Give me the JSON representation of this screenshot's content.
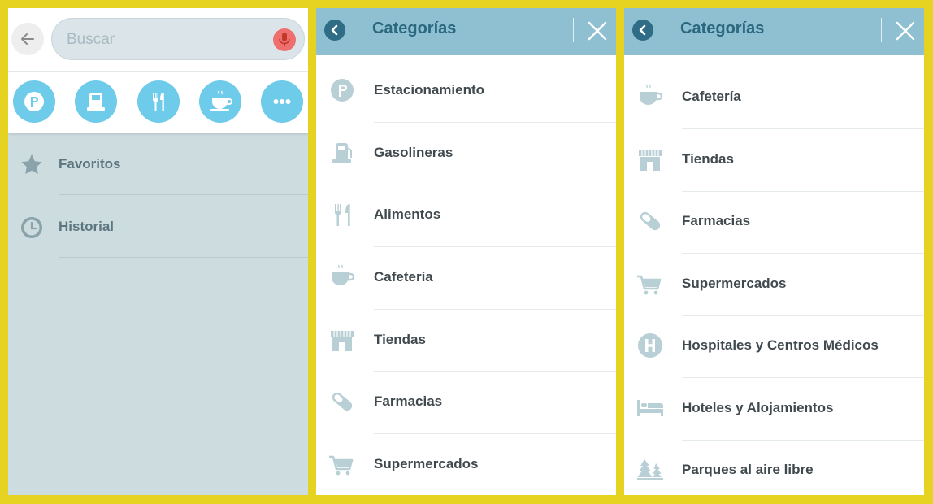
{
  "search_panel": {
    "search_placeholder": "Buscar",
    "quick_categories": [
      "parking-icon",
      "gas-station-icon",
      "food-icon",
      "coffee-icon",
      "more-icon"
    ],
    "items": [
      {
        "label": "Favoritos",
        "icon": "star-icon"
      },
      {
        "label": "Historial",
        "icon": "clock-icon"
      }
    ]
  },
  "categories_panel_1": {
    "title": "Categorías",
    "items": [
      {
        "label": "Estacionamiento",
        "icon": "parking-icon"
      },
      {
        "label": "Gasolineras",
        "icon": "gas-station-icon"
      },
      {
        "label": "Alimentos",
        "icon": "food-icon"
      },
      {
        "label": "Cafetería",
        "icon": "coffee-icon"
      },
      {
        "label": "Tiendas",
        "icon": "store-icon"
      },
      {
        "label": "Farmacias",
        "icon": "pill-icon"
      },
      {
        "label": "Supermercados",
        "icon": "cart-icon"
      }
    ]
  },
  "categories_panel_2": {
    "title": "Categorías",
    "items": [
      {
        "label": "Cafetería",
        "icon": "coffee-icon"
      },
      {
        "label": "Tiendas",
        "icon": "store-icon"
      },
      {
        "label": "Farmacias",
        "icon": "pill-icon"
      },
      {
        "label": "Supermercados",
        "icon": "cart-icon"
      },
      {
        "label": "Hospitales y Centros Médicos",
        "icon": "hospital-icon"
      },
      {
        "label": "Hoteles y Alojamientos",
        "icon": "bed-icon"
      },
      {
        "label": "Parques al aire libre",
        "icon": "trees-icon"
      }
    ]
  },
  "colors": {
    "frame": "#e6d221",
    "header": "#8ec0d2",
    "header_text": "#2b6880",
    "accent_circle": "#6ecbe9",
    "mic": "#ef6f6f",
    "icon_gray": "#b8cfd6"
  }
}
